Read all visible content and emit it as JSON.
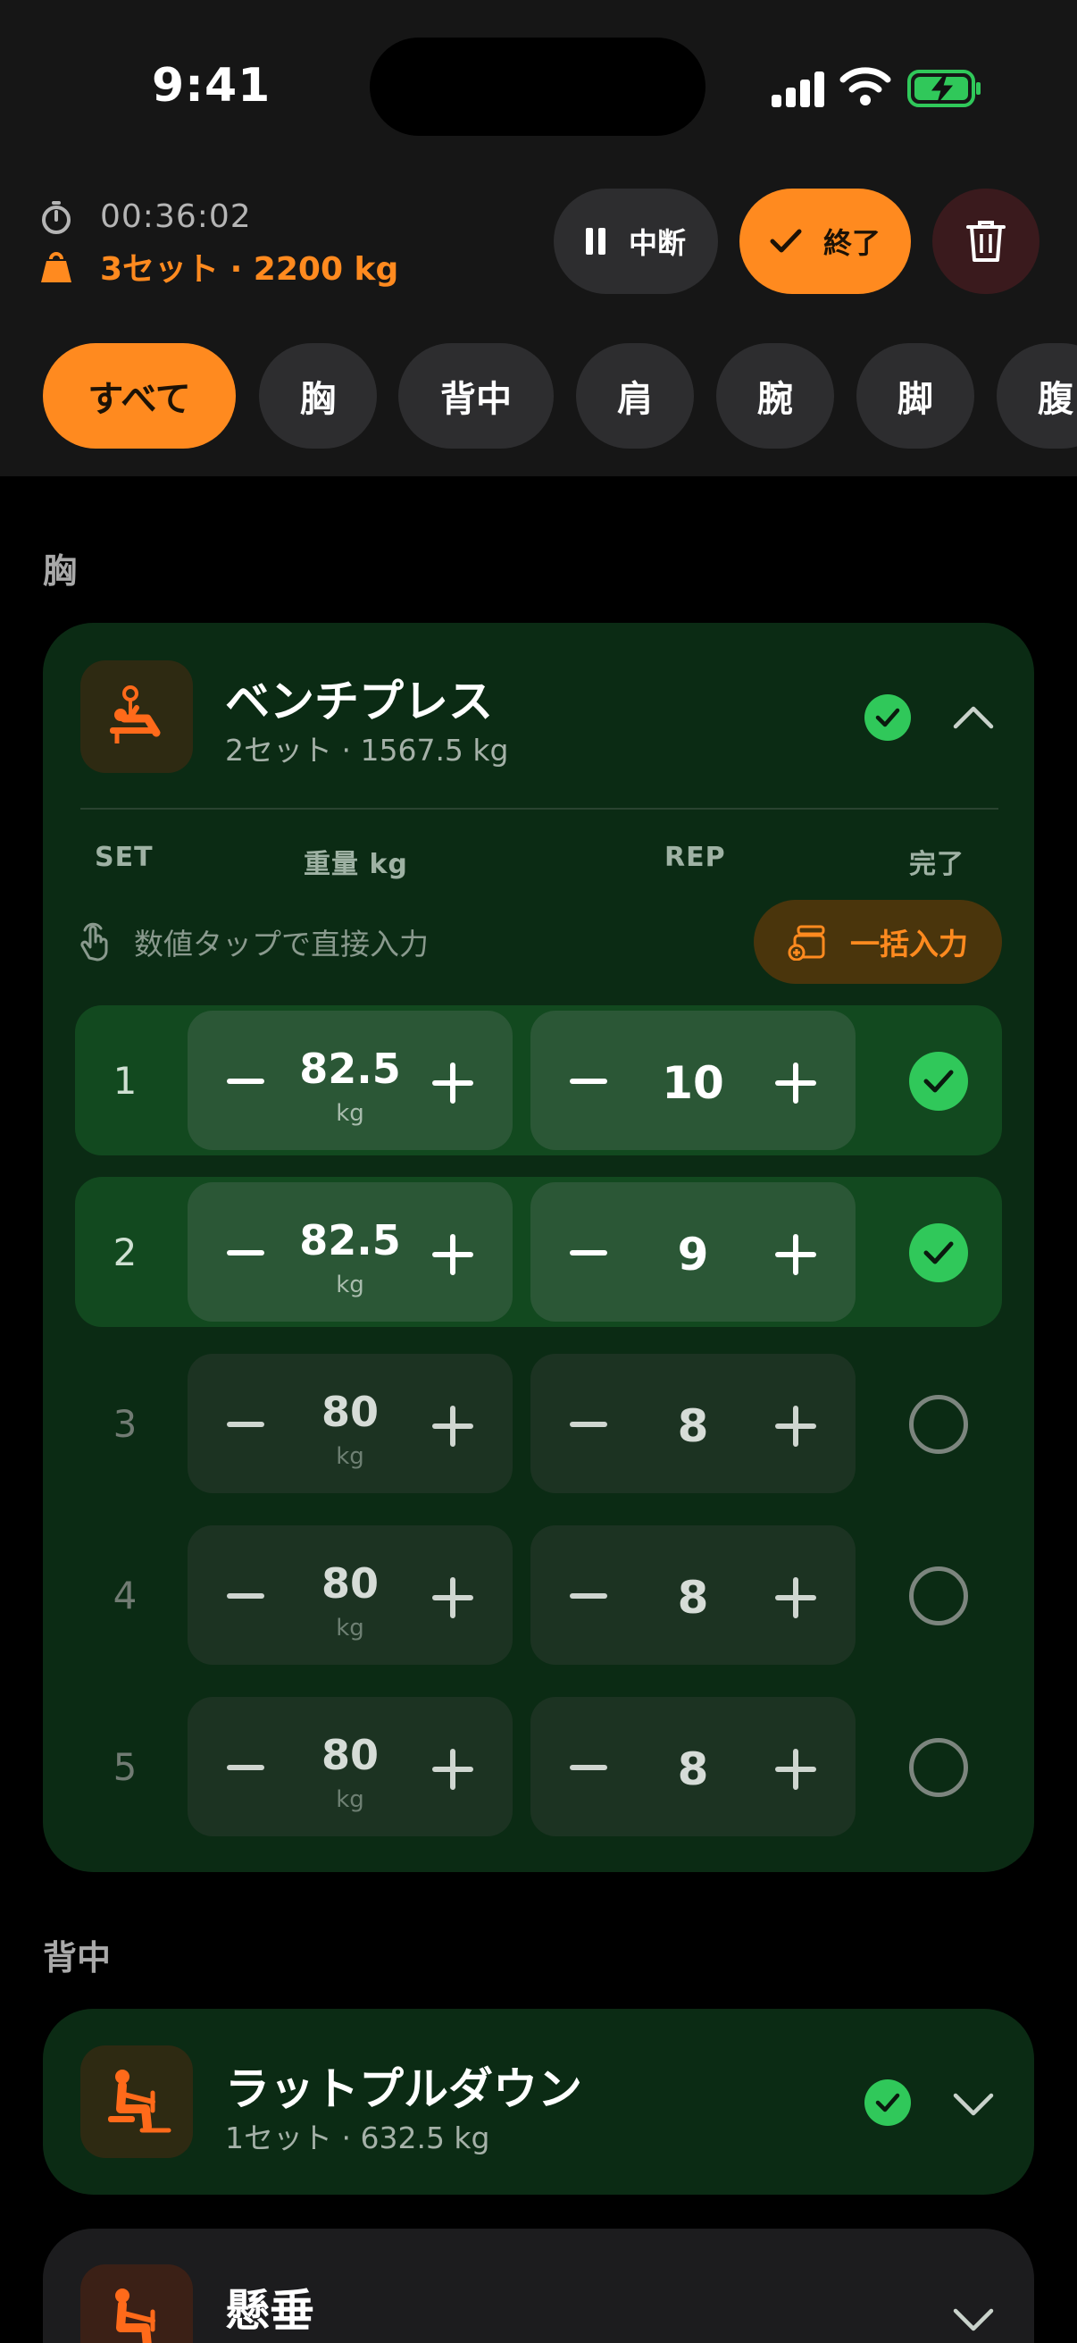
{
  "status_bar": {
    "time": "9:41"
  },
  "workout": {
    "elapsed": "00:36:02",
    "summary": "3セット · 2200 kg",
    "pause_label": "中断",
    "end_label": "終了"
  },
  "filters": [
    {
      "label": "すべて",
      "active": true
    },
    {
      "label": "胸",
      "active": false
    },
    {
      "label": "背中",
      "active": false
    },
    {
      "label": "肩",
      "active": false
    },
    {
      "label": "腕",
      "active": false
    },
    {
      "label": "脚",
      "active": false
    },
    {
      "label": "腹",
      "active": false
    }
  ],
  "sections": [
    {
      "label": "胸"
    },
    {
      "label": "背中"
    }
  ],
  "bench": {
    "name": "ベンチプレス",
    "summary": "2セット · 1567.5 kg",
    "columns": {
      "set": "SET",
      "weight": "重量 kg",
      "rep": "REP",
      "done": "完了"
    },
    "hint": "数値タップで直接入力",
    "bulk_label": "一括入力",
    "unit": "kg",
    "sets": [
      {
        "num": "1",
        "weight": "82.5",
        "reps": "10",
        "done": true
      },
      {
        "num": "2",
        "weight": "82.5",
        "reps": "9",
        "done": true
      },
      {
        "num": "3",
        "weight": "80",
        "reps": "8",
        "done": false
      },
      {
        "num": "4",
        "weight": "80",
        "reps": "8",
        "done": false
      },
      {
        "num": "5",
        "weight": "80",
        "reps": "8",
        "done": false
      }
    ]
  },
  "lat": {
    "name": "ラットプルダウン",
    "summary": "1セット · 632.5 kg"
  },
  "hang": {
    "name": "懸垂"
  },
  "colors": {
    "accent": "#ff8a1f",
    "done_green": "#30c85a",
    "card_green": "#0b2b14"
  }
}
